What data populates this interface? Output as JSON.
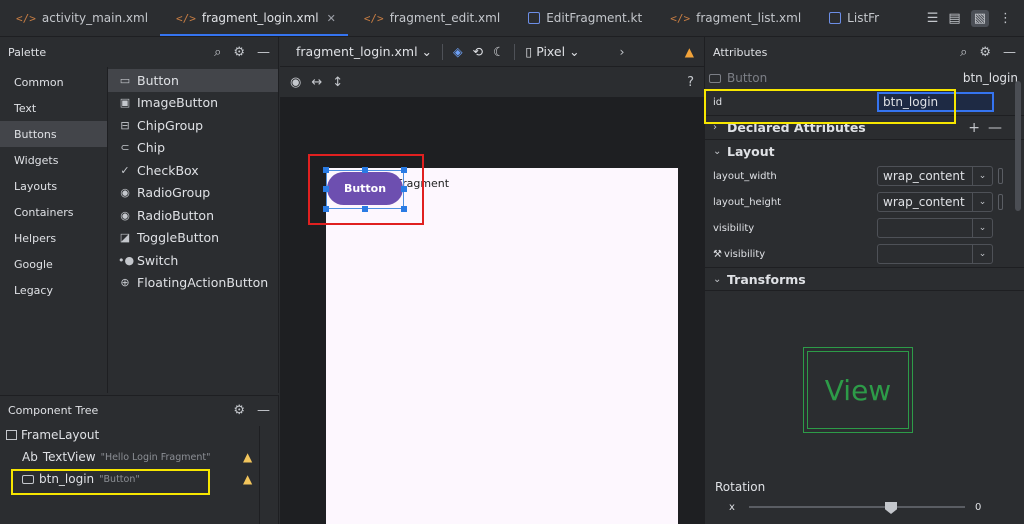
{
  "tabs": [
    {
      "label": "activity_main.xml",
      "icon": "xml-file-icon"
    },
    {
      "label": "fragment_login.xml",
      "icon": "xml-file-icon",
      "active": true,
      "close": "✕"
    },
    {
      "label": "fragment_edit.xml",
      "icon": "xml-file-icon"
    },
    {
      "label": "EditFragment.kt",
      "icon": "kotlin-file-icon"
    },
    {
      "label": "fragment_list.xml",
      "icon": "xml-file-icon"
    },
    {
      "label": "ListFr",
      "icon": "kotlin-file-icon"
    }
  ],
  "palette": {
    "title": "Palette",
    "categories": [
      "Common",
      "Text",
      "Buttons",
      "Widgets",
      "Layouts",
      "Containers",
      "Helpers",
      "Google",
      "Legacy"
    ],
    "selected_category": "Buttons",
    "items": [
      "Button",
      "ImageButton",
      "ChipGroup",
      "Chip",
      "CheckBox",
      "RadioGroup",
      "RadioButton",
      "ToggleButton",
      "Switch",
      "FloatingActionButton"
    ]
  },
  "component_tree": {
    "title": "Component Tree",
    "root": "FrameLayout",
    "children": [
      {
        "name": "TextView",
        "prefix": "Ab",
        "subtitle": "\"Hello Login Fragment\"",
        "warning": true
      },
      {
        "name": "btn_login",
        "subtitle": "\"Button\"",
        "warning": true
      }
    ]
  },
  "editor": {
    "file": "fragment_login.xml ⌄",
    "device": "Pixel ⌄",
    "help": "?",
    "canvas_text": "Hello Login Fragment",
    "button_label": "Button"
  },
  "attributes": {
    "title": "Attributes",
    "component_type": "Button",
    "component_id": "btn_login",
    "id_label": "id",
    "id_value": "btn_login",
    "declared": "Declared Attributes",
    "layout": "Layout",
    "rows": [
      {
        "label": "layout_width",
        "value": "wrap_content"
      },
      {
        "label": "layout_height",
        "value": "wrap_content"
      },
      {
        "label": "visibility",
        "value": ""
      },
      {
        "label": "visibility",
        "value": "",
        "tool": true
      }
    ],
    "transforms": "Transforms",
    "view_label": "View",
    "rotation": "Rotation",
    "rotation_axis": "x",
    "rotation_value": "0"
  },
  "colors": {
    "accent": "#3574f0",
    "highlight_yellow": "#f7e600",
    "highlight_red": "#e02020",
    "button_purple": "#6d4fb0",
    "warning": "#f2c55c"
  }
}
